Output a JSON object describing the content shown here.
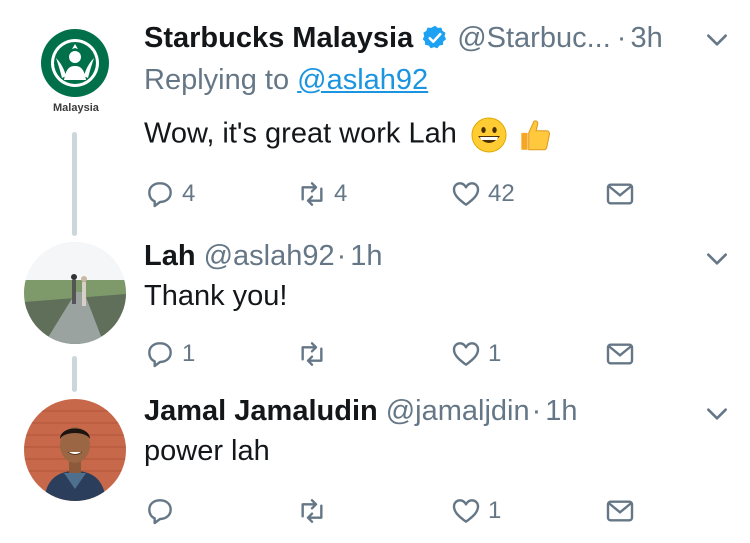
{
  "tweets": [
    {
      "name": "Starbucks Malaysia",
      "handle": "@Starbuc...",
      "time": "3h",
      "verified": true,
      "replying_label": "Replying to",
      "replying_handle": "@aslah92",
      "avatar_caption": "Malaysia",
      "text": "Wow, it's great work Lah",
      "emojis": [
        "grinning-face-emoji",
        "thumbs-up-emoji"
      ],
      "replies": "4",
      "retweets": "4",
      "likes": "42"
    },
    {
      "name": "Lah",
      "handle": "@aslah92",
      "time": "1h",
      "verified": false,
      "text": "Thank you!",
      "replies": "1",
      "retweets": "",
      "likes": "1"
    },
    {
      "name": "Jamal Jamaludin",
      "handle": "@jamaljdin",
      "time": "1h",
      "verified": false,
      "text": "power lah",
      "replies": "",
      "retweets": "",
      "likes": "1"
    }
  ],
  "colors": {
    "text": "#14171a",
    "secondary": "#657786",
    "link": "#1b95e0",
    "verified": "#1da1f2",
    "thread_line": "#ccd6dd",
    "starbucks_green": "#00704a"
  },
  "icons": [
    "reply-icon",
    "retweet-icon",
    "like-icon",
    "direct-message-icon",
    "chevron-down-icon",
    "verified-badge-icon"
  ]
}
